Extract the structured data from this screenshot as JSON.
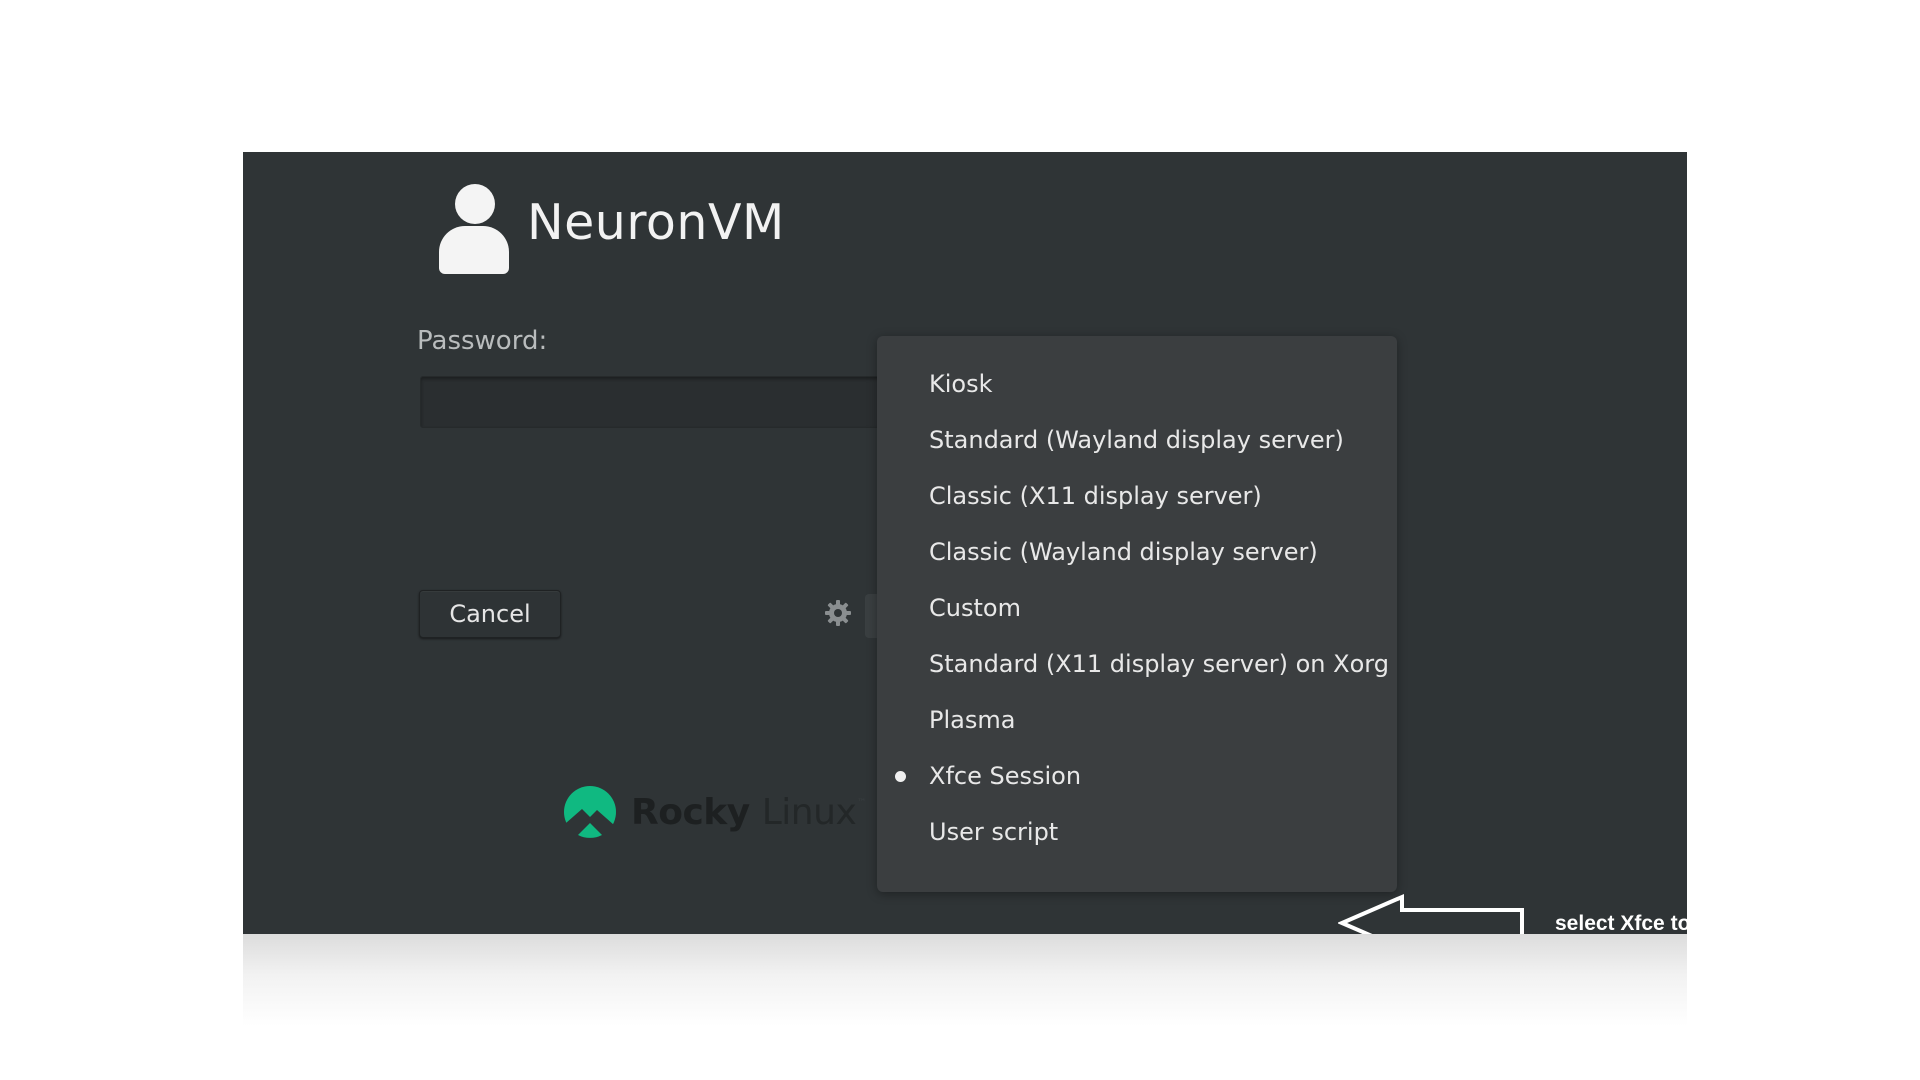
{
  "login": {
    "username": "NeuronVM",
    "password_label": "Password:",
    "password_value": "",
    "cancel_label": "Cancel",
    "settings_icon": "gear-icon",
    "avatar_icon": "user-avatar-icon"
  },
  "session_menu": {
    "items": [
      {
        "label": "Kiosk",
        "selected": false
      },
      {
        "label": "Standard (Wayland display server)",
        "selected": false
      },
      {
        "label": "Classic (X11 display server)",
        "selected": false
      },
      {
        "label": "Classic (Wayland display server)",
        "selected": false
      },
      {
        "label": "Custom",
        "selected": false
      },
      {
        "label": "Standard (X11 display server) on Xorg",
        "selected": false
      },
      {
        "label": "Plasma",
        "selected": false
      },
      {
        "label": "Xfce Session",
        "selected": true
      },
      {
        "label": "User script",
        "selected": false
      }
    ]
  },
  "branding": {
    "logo_icon": "rocky-linux-logo-icon",
    "logo_bold": "Rocky",
    "logo_light": "Linux",
    "logo_tm": "™"
  },
  "annotation": {
    "text": "select Xfce to use it as your GUI",
    "arrow_icon": "left-arrow-icon"
  },
  "colors": {
    "background": "#2f3436",
    "menu_background": "#3b3e40",
    "text": "#e8e8e8",
    "rocky_green": "#10b981"
  }
}
